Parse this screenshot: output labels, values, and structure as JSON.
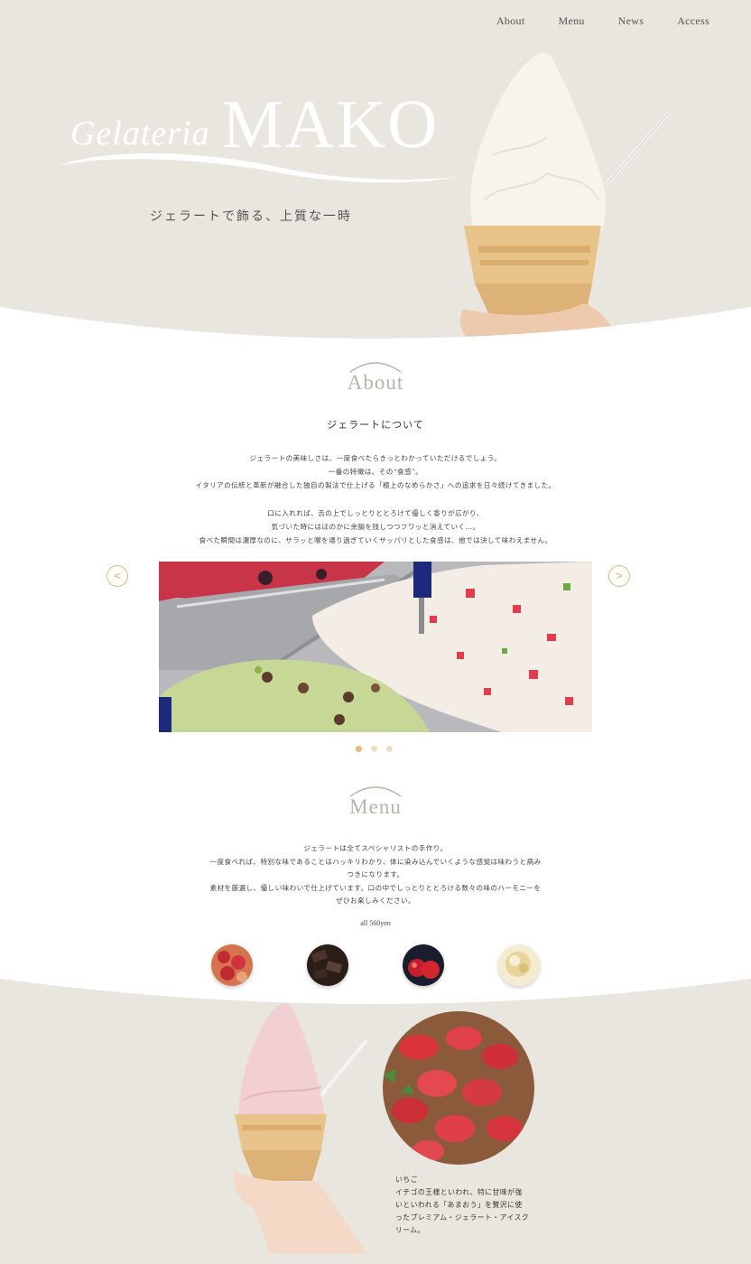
{
  "nav": {
    "items": [
      "About",
      "Menu",
      "News",
      "Access"
    ]
  },
  "hero": {
    "logo_script": "Gelateria",
    "logo_main": "MAKO",
    "tagline": "ジェラートで飾る、上質な一時"
  },
  "about": {
    "heading": "About",
    "subheading": "ジェラートについて",
    "paragraph1": [
      "ジェラートの美味しさは、一度食べたらきっとわかっていただけるでしょう。",
      "一番の特徴は、その“食感”。",
      "イタリアの伝統と革新が融合した独自の製法で仕上げる「極上のなめらかさ」への追求を日々続けてきました。"
    ],
    "paragraph2": [
      "口に入れれば、舌の上でしっとりととろけて優しく香りが広がり、",
      "気づいた時にはほのかに余韻を残しつつフワッと消えていく…。",
      "食べた瞬間は濃厚なのに、サラッと喉を通り過ぎていくサッパリとした食感は、他では決して味わえません。"
    ]
  },
  "slider": {
    "prev_label": "<",
    "next_label": ">",
    "dot_count": 3,
    "active_index": 0
  },
  "menu": {
    "heading": "Menu",
    "description": [
      "ジェラートは全てスペシャリストの手作り。",
      "一度食べれば、特別な味であることはハッキリわかり、体に染み込んでいくような感覚は味わうと病み",
      "つきになります。",
      "素材を厳選し、優しい味わいで仕上げています。口の中でしっとりととろける数々の味のハーモニーを",
      "ぜひお楽しみください。"
    ],
    "price": "all 560yen",
    "flavors": [
      "strawberry",
      "chocolate",
      "apple",
      "vanilla"
    ]
  },
  "featured": {
    "name": "いちご",
    "description": [
      "イチゴの王様といわれ、特に甘味が強",
      "いといわれる「あまおう」を贅沢に使",
      "ったプレミアム・ジェラート・アイスク",
      "リーム。"
    ]
  },
  "colors": {
    "beige": "#e9e6df",
    "accent": "#e9b878",
    "heading_gray": "#b9b4ab"
  }
}
